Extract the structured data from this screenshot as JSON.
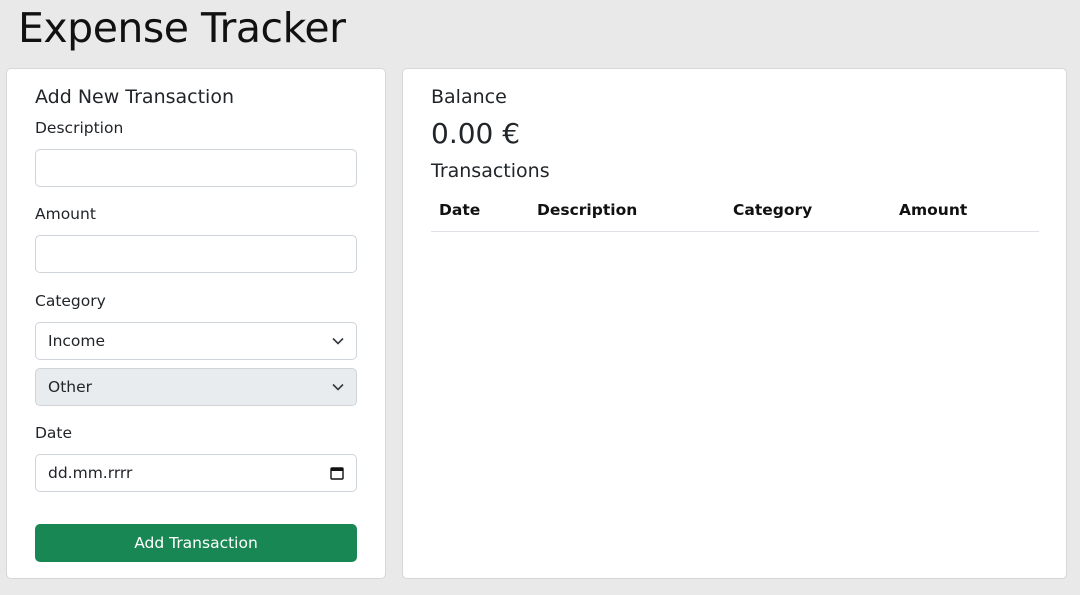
{
  "app": {
    "title": "Expense Tracker"
  },
  "form": {
    "title": "Add New Transaction",
    "description_label": "Description",
    "description_value": "",
    "amount_label": "Amount",
    "amount_value": "",
    "category_label": "Category",
    "type_value": "Income",
    "subcategory_value": "Other",
    "date_label": "Date",
    "date_placeholder": "dd.mm.rrrr",
    "submit_label": "Add Transaction"
  },
  "balance": {
    "title": "Balance",
    "amount": "0.00 €"
  },
  "transactions": {
    "title": "Transactions",
    "columns": [
      "Date",
      "Description",
      "Category",
      "Amount"
    ],
    "rows": []
  },
  "colors": {
    "primary_button": "#198754",
    "background": "#e9e9e9",
    "disabled_select": "#e9ecef"
  },
  "icons": {
    "select": "chevron-down-icon",
    "date": "calendar-icon"
  }
}
